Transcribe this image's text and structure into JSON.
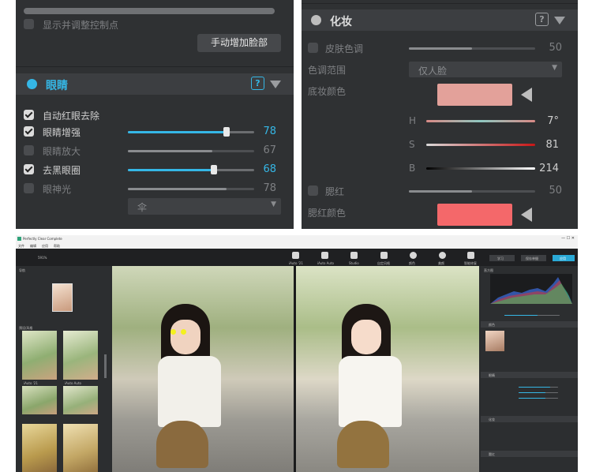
{
  "eyes_panel": {
    "show_controls_label": "显示并调整控制点",
    "add_face_button": "手动增加脸部",
    "section_title": "眼睛",
    "help_label": "?",
    "red_eye_label": "自动红眼去除",
    "sliders": [
      {
        "label": "眼睛增强",
        "value": "78",
        "checked": true,
        "active": true,
        "level": 0.78
      },
      {
        "label": "眼睛放大",
        "value": "67",
        "checked": false,
        "active": false,
        "level": 0.67
      },
      {
        "label": "去黑眼圈",
        "value": "68",
        "checked": true,
        "active": true,
        "level": 0.68
      },
      {
        "label": "眼神光",
        "value": "78",
        "checked": false,
        "active": false,
        "level": 0.78
      }
    ],
    "catchlight_select": "伞"
  },
  "makeup_panel": {
    "section_title": "化妆",
    "help_label": "?",
    "skin_tone_label": "皮肤色调",
    "skin_tone_value": "50",
    "skin_tone_level": 0.5,
    "tone_range_label": "色调范围",
    "tone_range_select": "仅人脸",
    "foundation_label": "底妆颜色",
    "foundation_color": "#e3a19a",
    "hsb": [
      {
        "label": "H",
        "value": "7°",
        "level": 0.55
      },
      {
        "label": "S",
        "value": "81",
        "level": 0.81
      },
      {
        "label": "B",
        "value": "214",
        "level": 0.84
      }
    ],
    "blush_label": "腮红",
    "blush_value": "50",
    "blush_level": 0.5,
    "blush_color_label": "腮红颜色",
    "blush_color": "#f4686a"
  },
  "app": {
    "title": "Perfectly Clear Complete",
    "menu": [
      "文件",
      "编辑",
      "应用",
      "帮助"
    ],
    "zoom": "591%",
    "tools": [
      "iAuto '21",
      "iAuto Auto",
      "Studio",
      "自定风格",
      "颜色",
      "美颜",
      "智能修复"
    ],
    "right_tabs": [
      "学习",
      "保存单摄",
      "应用"
    ],
    "histogram_label": "直方图",
    "section_labels": [
      "颜色",
      "颜色",
      "眼睛",
      "化妆",
      "腮红"
    ],
    "nav_label": "导航",
    "presets_label": "预设/风格",
    "thumbs": [
      "iAuto '21",
      "iAuto Auto",
      "",
      "",
      "",
      ""
    ]
  }
}
